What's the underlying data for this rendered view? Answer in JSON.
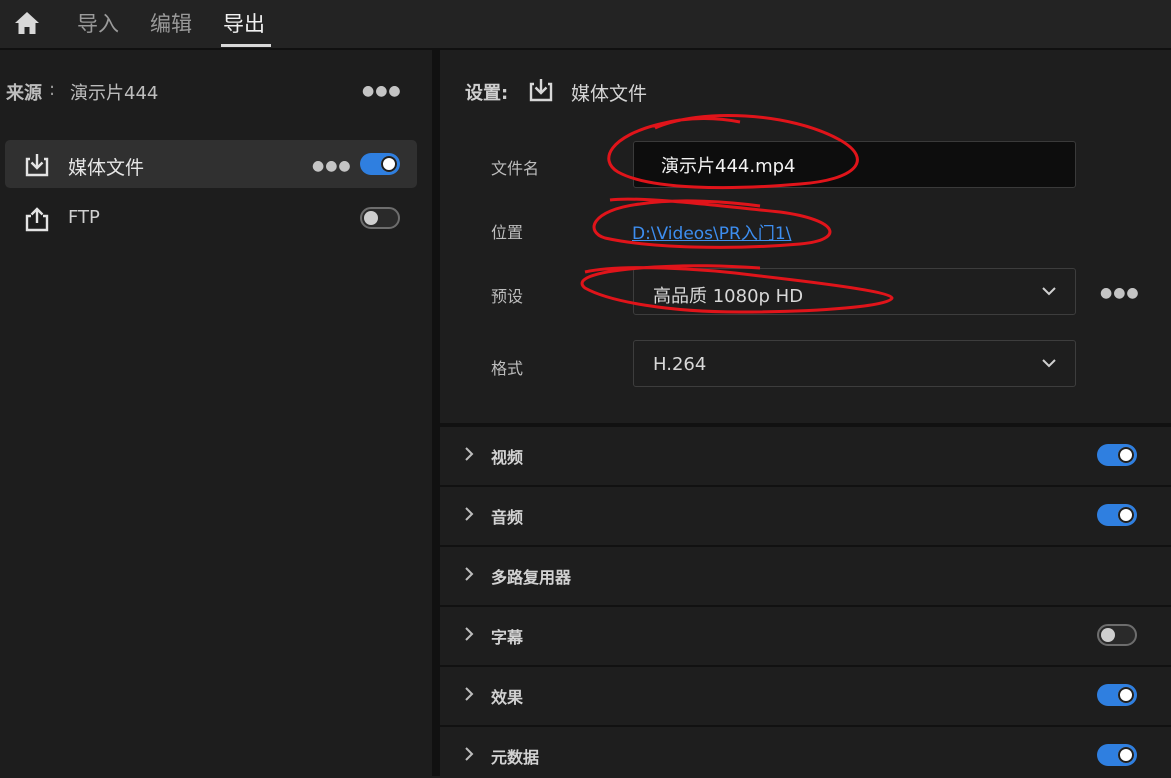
{
  "topbar": {
    "tabs": [
      {
        "label": "导入"
      },
      {
        "label": "编辑"
      },
      {
        "label": "导出"
      }
    ],
    "active_tab": "导出"
  },
  "source": {
    "label": "来源",
    "colon": ":",
    "name": "演示片444"
  },
  "destinations": [
    {
      "label": "媒体文件",
      "icon": "download-icon",
      "enabled": true,
      "selected": true
    },
    {
      "label": "FTP",
      "icon": "upload-icon",
      "enabled": false,
      "selected": false
    }
  ],
  "settings": {
    "label": "设置:",
    "target": "媒体文件",
    "filename_label": "文件名",
    "filename_value": "演示片444.mp4",
    "location_label": "位置",
    "location_value": "D:\\Videos\\PR入门1\\",
    "preset_label": "预设",
    "preset_value": "高品质 1080p HD",
    "format_label": "格式",
    "format_value": "H.264"
  },
  "sections": [
    {
      "title": "视频",
      "toggle": "on"
    },
    {
      "title": "音频",
      "toggle": "on"
    },
    {
      "title": "多路复用器",
      "toggle": "none"
    },
    {
      "title": "字幕",
      "toggle": "off"
    },
    {
      "title": "效果",
      "toggle": "on"
    },
    {
      "title": "元数据",
      "toggle": "on"
    }
  ],
  "colors": {
    "accent": "#2f7fe0",
    "link": "#3d8ef0",
    "annotation": "#e0141a"
  }
}
